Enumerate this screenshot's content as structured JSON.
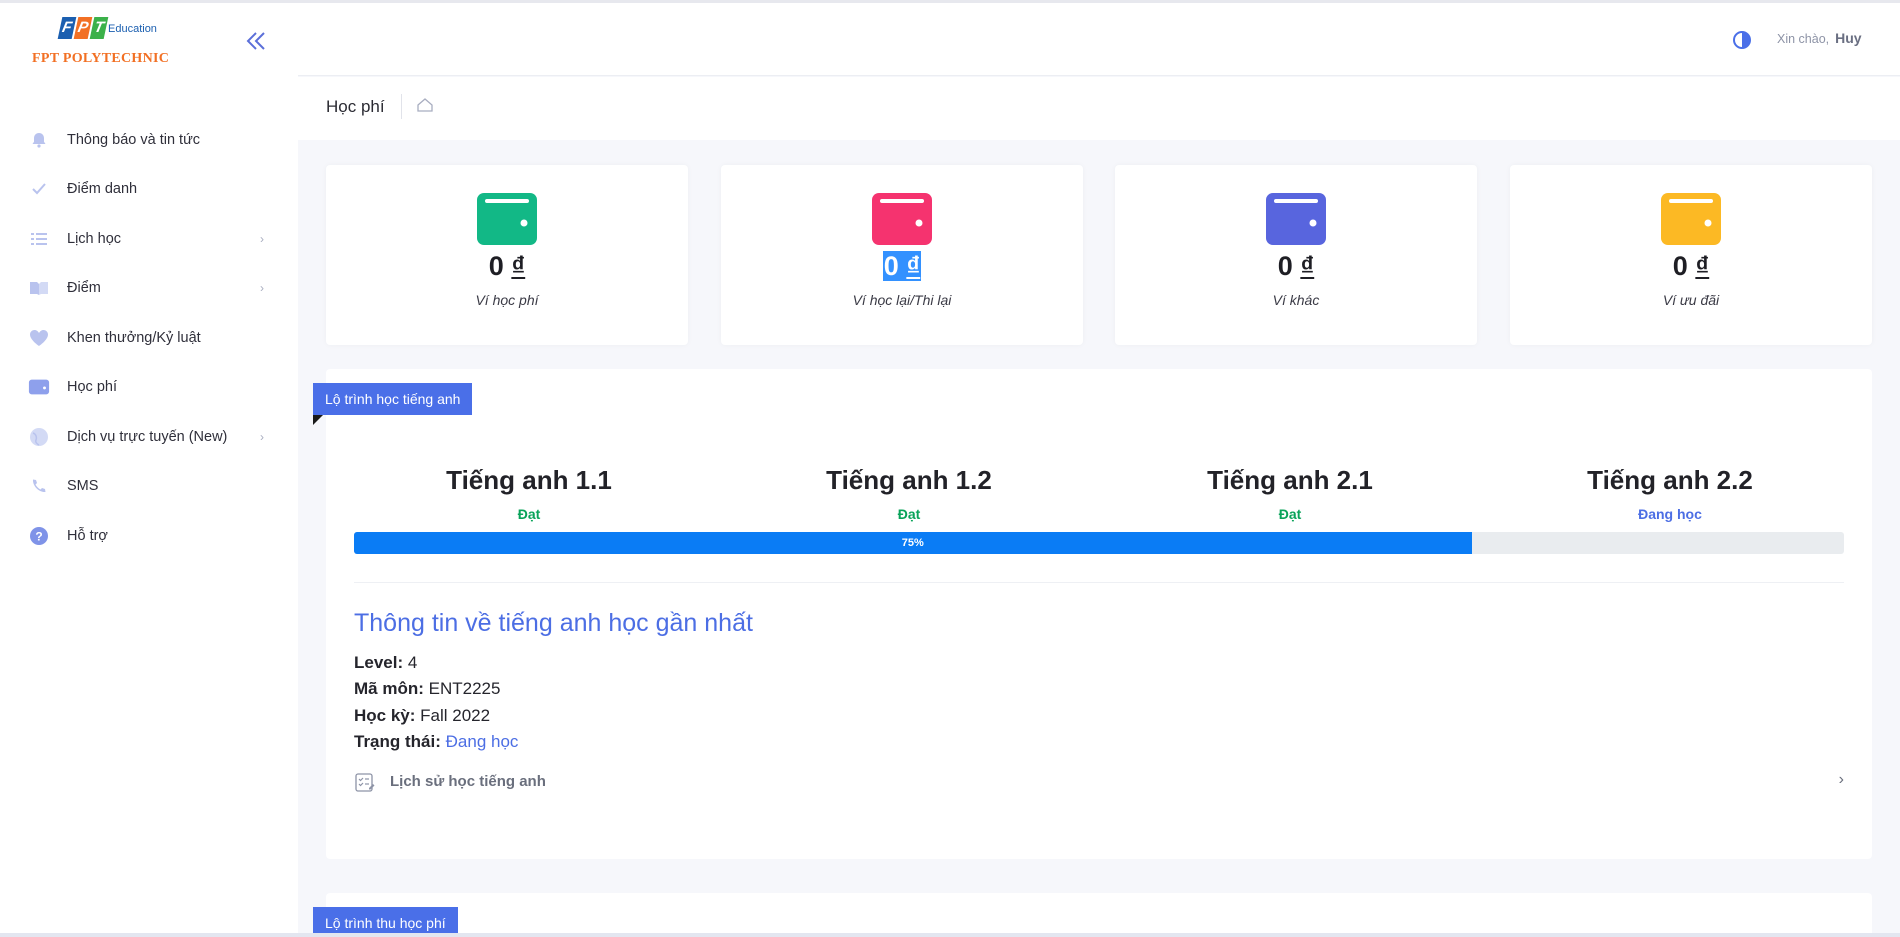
{
  "brand": {
    "logo_letters": [
      "F",
      "P",
      "T"
    ],
    "logo_sub": "Education",
    "logo_name": "FPT POLYTECHNIC"
  },
  "sidebar": {
    "items": [
      {
        "label": "Thông báo và tin tức",
        "icon": "bell-icon",
        "has_children": false
      },
      {
        "label": "Điểm danh",
        "icon": "check-icon",
        "has_children": false
      },
      {
        "label": "Lịch học",
        "icon": "list-icon",
        "has_children": true
      },
      {
        "label": "Điểm",
        "icon": "book-icon",
        "has_children": true
      },
      {
        "label": "Khen thưởng/Kỷ luật",
        "icon": "heart-icon",
        "has_children": false
      },
      {
        "label": "Học phí",
        "icon": "wallet-icon",
        "has_children": false
      },
      {
        "label": "Dịch vụ trực tuyến (New)",
        "icon": "globe-icon",
        "has_children": true
      },
      {
        "label": "SMS",
        "icon": "phone-icon",
        "has_children": false
      },
      {
        "label": "Hỗ trợ",
        "icon": "help-icon",
        "has_children": false
      }
    ],
    "chevron": "›"
  },
  "header": {
    "greeting": "Xin chào,",
    "user_name": "Huy"
  },
  "breadcrumb": {
    "title": "Học phí"
  },
  "wallets": [
    {
      "amount_value": "0",
      "amount_unit": "₫",
      "label": "Ví học phí",
      "color": "#12b886",
      "highlighted": false
    },
    {
      "amount_value": "0",
      "amount_unit": "₫",
      "label": "Ví học lại/Thi lại",
      "color": "#f5336f",
      "highlighted": true
    },
    {
      "amount_value": "0",
      "amount_unit": "₫",
      "label": "Ví khác",
      "color": "#5865de",
      "highlighted": false
    },
    {
      "amount_value": "0",
      "amount_unit": "₫",
      "label": "Ví ưu đãi",
      "color": "#fcb924",
      "highlighted": false
    }
  ],
  "english": {
    "ribbon": "Lộ trình học tiếng anh",
    "levels": [
      {
        "name": "Tiếng anh 1.1",
        "status": "Đạt",
        "status_color": "#0aa35a"
      },
      {
        "name": "Tiếng anh 1.2",
        "status": "Đạt",
        "status_color": "#0aa35a"
      },
      {
        "name": "Tiếng anh 2.1",
        "status": "Đạt",
        "status_color": "#0aa35a"
      },
      {
        "name": "Tiếng anh 2.2",
        "status": "Đang học",
        "status_color": "#4c6ee4"
      }
    ],
    "progress_percent": 75,
    "progress_label": "75%",
    "info_title": "Thông tin về tiếng anh học gần nhất",
    "info": {
      "level_label": "Level:",
      "level_value": "4",
      "subject_label": "Mã môn:",
      "subject_value": "ENT2225",
      "term_label": "Học kỳ:",
      "term_value": "Fall 2022",
      "status_label": "Trạng thái:",
      "status_value": "Đang học"
    },
    "history_label": "Lịch sử học tiếng anh",
    "history_chevron": "›"
  },
  "fees": {
    "ribbon": "Lộ trình thu học phí"
  },
  "colors": {
    "accent": "#4a6fe8",
    "progress": "#0a7cf5",
    "logo_orange": "#f27024"
  }
}
